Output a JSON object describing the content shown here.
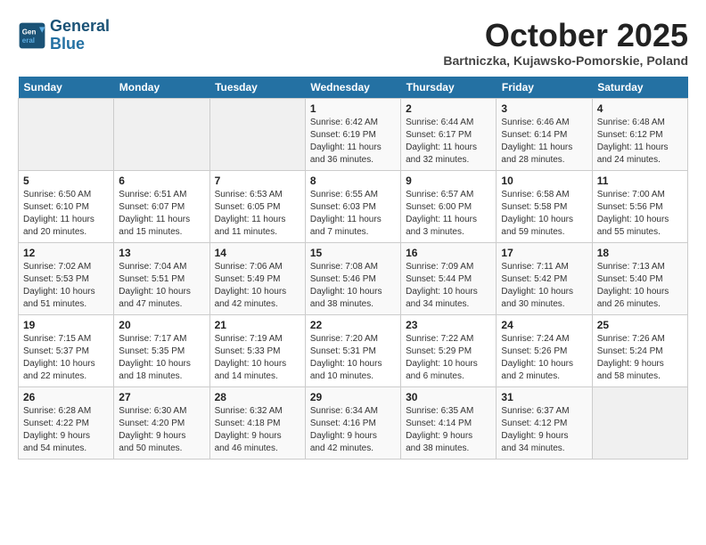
{
  "logo": {
    "line1": "General",
    "line2": "Blue"
  },
  "title": "October 2025",
  "subtitle": "Bartniczka, Kujawsko-Pomorskie, Poland",
  "headers": [
    "Sunday",
    "Monday",
    "Tuesday",
    "Wednesday",
    "Thursday",
    "Friday",
    "Saturday"
  ],
  "weeks": [
    [
      {
        "day": "",
        "info": ""
      },
      {
        "day": "",
        "info": ""
      },
      {
        "day": "",
        "info": ""
      },
      {
        "day": "1",
        "info": "Sunrise: 6:42 AM\nSunset: 6:19 PM\nDaylight: 11 hours\nand 36 minutes."
      },
      {
        "day": "2",
        "info": "Sunrise: 6:44 AM\nSunset: 6:17 PM\nDaylight: 11 hours\nand 32 minutes."
      },
      {
        "day": "3",
        "info": "Sunrise: 6:46 AM\nSunset: 6:14 PM\nDaylight: 11 hours\nand 28 minutes."
      },
      {
        "day": "4",
        "info": "Sunrise: 6:48 AM\nSunset: 6:12 PM\nDaylight: 11 hours\nand 24 minutes."
      }
    ],
    [
      {
        "day": "5",
        "info": "Sunrise: 6:50 AM\nSunset: 6:10 PM\nDaylight: 11 hours\nand 20 minutes."
      },
      {
        "day": "6",
        "info": "Sunrise: 6:51 AM\nSunset: 6:07 PM\nDaylight: 11 hours\nand 15 minutes."
      },
      {
        "day": "7",
        "info": "Sunrise: 6:53 AM\nSunset: 6:05 PM\nDaylight: 11 hours\nand 11 minutes."
      },
      {
        "day": "8",
        "info": "Sunrise: 6:55 AM\nSunset: 6:03 PM\nDaylight: 11 hours\nand 7 minutes."
      },
      {
        "day": "9",
        "info": "Sunrise: 6:57 AM\nSunset: 6:00 PM\nDaylight: 11 hours\nand 3 minutes."
      },
      {
        "day": "10",
        "info": "Sunrise: 6:58 AM\nSunset: 5:58 PM\nDaylight: 10 hours\nand 59 minutes."
      },
      {
        "day": "11",
        "info": "Sunrise: 7:00 AM\nSunset: 5:56 PM\nDaylight: 10 hours\nand 55 minutes."
      }
    ],
    [
      {
        "day": "12",
        "info": "Sunrise: 7:02 AM\nSunset: 5:53 PM\nDaylight: 10 hours\nand 51 minutes."
      },
      {
        "day": "13",
        "info": "Sunrise: 7:04 AM\nSunset: 5:51 PM\nDaylight: 10 hours\nand 47 minutes."
      },
      {
        "day": "14",
        "info": "Sunrise: 7:06 AM\nSunset: 5:49 PM\nDaylight: 10 hours\nand 42 minutes."
      },
      {
        "day": "15",
        "info": "Sunrise: 7:08 AM\nSunset: 5:46 PM\nDaylight: 10 hours\nand 38 minutes."
      },
      {
        "day": "16",
        "info": "Sunrise: 7:09 AM\nSunset: 5:44 PM\nDaylight: 10 hours\nand 34 minutes."
      },
      {
        "day": "17",
        "info": "Sunrise: 7:11 AM\nSunset: 5:42 PM\nDaylight: 10 hours\nand 30 minutes."
      },
      {
        "day": "18",
        "info": "Sunrise: 7:13 AM\nSunset: 5:40 PM\nDaylight: 10 hours\nand 26 minutes."
      }
    ],
    [
      {
        "day": "19",
        "info": "Sunrise: 7:15 AM\nSunset: 5:37 PM\nDaylight: 10 hours\nand 22 minutes."
      },
      {
        "day": "20",
        "info": "Sunrise: 7:17 AM\nSunset: 5:35 PM\nDaylight: 10 hours\nand 18 minutes."
      },
      {
        "day": "21",
        "info": "Sunrise: 7:19 AM\nSunset: 5:33 PM\nDaylight: 10 hours\nand 14 minutes."
      },
      {
        "day": "22",
        "info": "Sunrise: 7:20 AM\nSunset: 5:31 PM\nDaylight: 10 hours\nand 10 minutes."
      },
      {
        "day": "23",
        "info": "Sunrise: 7:22 AM\nSunset: 5:29 PM\nDaylight: 10 hours\nand 6 minutes."
      },
      {
        "day": "24",
        "info": "Sunrise: 7:24 AM\nSunset: 5:26 PM\nDaylight: 10 hours\nand 2 minutes."
      },
      {
        "day": "25",
        "info": "Sunrise: 7:26 AM\nSunset: 5:24 PM\nDaylight: 9 hours\nand 58 minutes."
      }
    ],
    [
      {
        "day": "26",
        "info": "Sunrise: 6:28 AM\nSunset: 4:22 PM\nDaylight: 9 hours\nand 54 minutes."
      },
      {
        "day": "27",
        "info": "Sunrise: 6:30 AM\nSunset: 4:20 PM\nDaylight: 9 hours\nand 50 minutes."
      },
      {
        "day": "28",
        "info": "Sunrise: 6:32 AM\nSunset: 4:18 PM\nDaylight: 9 hours\nand 46 minutes."
      },
      {
        "day": "29",
        "info": "Sunrise: 6:34 AM\nSunset: 4:16 PM\nDaylight: 9 hours\nand 42 minutes."
      },
      {
        "day": "30",
        "info": "Sunrise: 6:35 AM\nSunset: 4:14 PM\nDaylight: 9 hours\nand 38 minutes."
      },
      {
        "day": "31",
        "info": "Sunrise: 6:37 AM\nSunset: 4:12 PM\nDaylight: 9 hours\nand 34 minutes."
      },
      {
        "day": "",
        "info": ""
      }
    ]
  ]
}
